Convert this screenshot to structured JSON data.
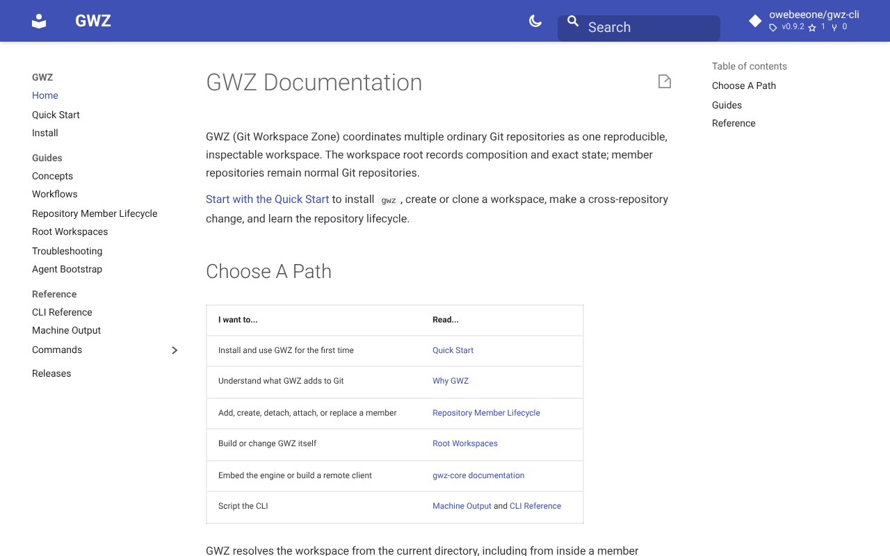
{
  "header": {
    "site_title": "GWZ",
    "search": {
      "placeholder": "Search"
    },
    "repo": {
      "name": "owebeeone/gwz-cli",
      "version": "v0.9.2",
      "stars": "1",
      "forks": "0"
    }
  },
  "sidebar": {
    "title": "GWZ",
    "sections": [
      {
        "items": [
          {
            "label": "Home",
            "selected": true
          },
          {
            "label": "Quick Start",
            "selected": false
          },
          {
            "label": "Install",
            "selected": false
          }
        ]
      },
      {
        "title": "Guides",
        "items": [
          {
            "label": "Concepts",
            "selected": false
          },
          {
            "label": "Workflows",
            "selected": false
          },
          {
            "label": "Repository Member Lifecycle",
            "selected": false
          },
          {
            "label": "Root Workspaces",
            "selected": false
          },
          {
            "label": "Troubleshooting",
            "selected": false
          },
          {
            "label": "Agent Bootstrap",
            "selected": false
          }
        ]
      },
      {
        "title": "Reference",
        "items": [
          {
            "label": "CLI Reference",
            "selected": false
          },
          {
            "label": "Machine Output",
            "selected": false
          },
          {
            "label": "Commands",
            "selected": false,
            "expanded": false
          }
        ]
      },
      {
        "items": [
          {
            "label": "Releases",
            "selected": false
          }
        ]
      }
    ]
  },
  "content": {
    "title": "GWZ Documentation",
    "intro": "GWZ (Git Workspace Zone) coordinates multiple ordinary Git repositories as one reproducible, inspectable workspace. The workspace root records composition and exact state; member repositories remain normal Git repositories.",
    "start": [
      {
        "kind": "link",
        "text": "Start with the Quick Start"
      },
      {
        "kind": "text",
        "text": " to install "
      },
      {
        "kind": "code",
        "text": "gwz"
      },
      {
        "kind": "text",
        "text": ", create or clone a workspace, make a cross-repository change, and learn the repository lifecycle."
      }
    ],
    "section_title": "Choose A Path",
    "table": {
      "columns": [
        "I want to...",
        "Read..."
      ],
      "rows": [
        {
          "want": "Install and use GWZ for the first time",
          "read": [
            {
              "kind": "link",
              "text": "Quick Start"
            }
          ]
        },
        {
          "want": "Understand what GWZ adds to Git",
          "read": [
            {
              "kind": "link",
              "text": "Why GWZ"
            }
          ]
        },
        {
          "want": "Add, create, detach, attach, or replace a member",
          "read": [
            {
              "kind": "link",
              "text": "Repository Member Lifecycle"
            }
          ]
        },
        {
          "want": "Build or change GWZ itself",
          "read": [
            {
              "kind": "link",
              "text": "Root Workspaces"
            }
          ]
        },
        {
          "want": "Embed the engine or build a remote client",
          "read": [
            {
              "kind": "link",
              "text": "gwz-core documentation"
            }
          ]
        },
        {
          "want": "Script the CLI",
          "read": [
            {
              "kind": "link",
              "text": "Machine Output"
            },
            {
              "kind": "text",
              "text": " and "
            },
            {
              "kind": "link",
              "text": "CLI Reference"
            }
          ]
        }
      ]
    },
    "outro": "GWZ resolves the workspace from the current directory, including from inside a member"
  },
  "toc": {
    "title": "Table of contents",
    "items": [
      "Choose A Path",
      "Guides",
      "Reference"
    ]
  }
}
